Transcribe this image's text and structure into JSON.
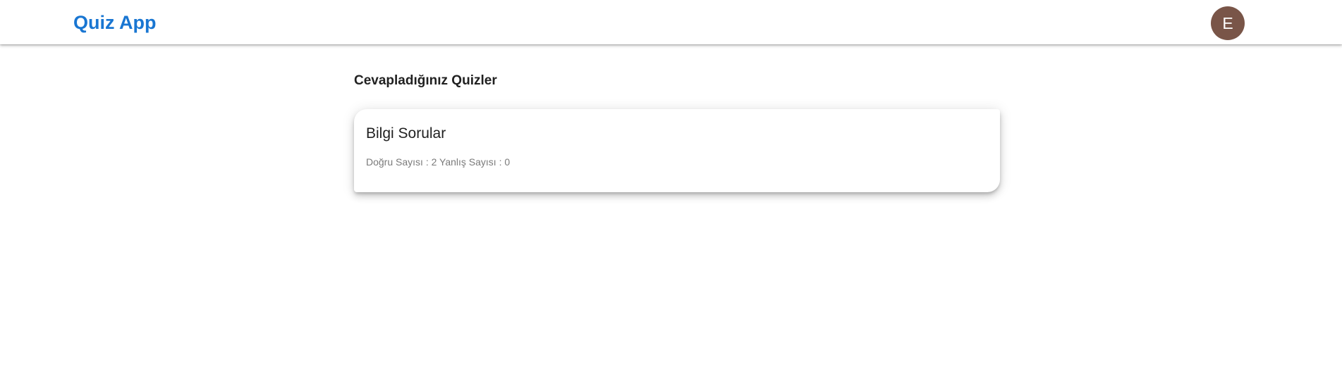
{
  "header": {
    "app_title": "Quiz App",
    "avatar_initial": "E"
  },
  "colors": {
    "brand": "#1976d2",
    "avatar_bg": "#795548"
  },
  "main": {
    "section_title": "Cevapladığınız Quizler",
    "quizzes": [
      {
        "title": "Bilgi Sorular",
        "stats": "Doğru Sayısı : 2 Yanlış Sayısı : 0"
      }
    ]
  }
}
